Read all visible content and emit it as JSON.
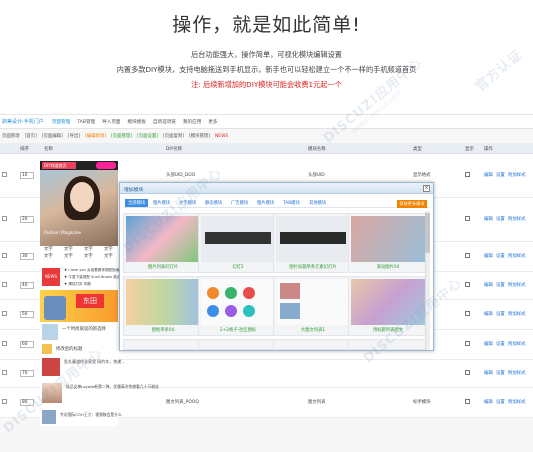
{
  "hero": {
    "title": "操作，就是如此简单!",
    "line1": "后台功能强大，操作简单，可视化模块编辑设置",
    "line2": "内置多款DIY模块，支持电脑拖送到手机显示，新手也可以轻松建立一个不一样的手机频道首页",
    "line3": "注: 后续新增加的DIY模块可能会收费1元起一个"
  },
  "topnav": {
    "brand": "启美设计-手机门户",
    "items": [
      "页面管理",
      "TAB管理",
      "导入页面",
      "模块模板",
      "自新选项链",
      "我的应用",
      "更多"
    ]
  },
  "subnav": {
    "items": [
      "页面管理",
      "[首页]",
      "[页面编辑]",
      "[导出]",
      "[编辑新增]",
      "[页面管理]",
      "[页面设置]",
      "[页面复制]",
      "[模块管理]",
      "NEWS"
    ]
  },
  "table": {
    "headers": [
      "排序",
      "名称",
      "DIY名称",
      "模块名称",
      "类型",
      "显示",
      "操作"
    ],
    "rows": [
      {
        "order": "10",
        "diy": "头部UID_DOO",
        "module": "头部UID",
        "module2": "头部UID",
        "type": "显示格式"
      },
      {
        "order": "20",
        "diy": "",
        "module": "",
        "module2": "",
        "type": ""
      },
      {
        "order": "30",
        "diy": "",
        "module": "",
        "module2": "",
        "type": ""
      },
      {
        "order": "40",
        "diy": "",
        "module": "",
        "module2": "",
        "type": ""
      },
      {
        "order": "50",
        "diy": "",
        "module": "",
        "module2": "",
        "type": ""
      },
      {
        "order": "60",
        "diy": "",
        "module": "",
        "module2": "",
        "type": ""
      },
      {
        "order": "70",
        "diy": "",
        "module": "",
        "module2": "",
        "type": ""
      },
      {
        "order": "80",
        "diy": "图文列表_POOQ",
        "module": "图文列表",
        "module2": "",
        "type": "标手模块"
      }
    ],
    "actions": [
      "编辑",
      "设置",
      "附加样式"
    ]
  },
  "left_preview": {
    "logo": "DIY频道首页",
    "caption": "Fashion Magazine",
    "bunk_texts": [
      "文字",
      "文字",
      "文字",
      "文字",
      "文字",
      "文字",
      "文字",
      "文字"
    ],
    "news": [
      "♦ I love you 女孩看服饰搭配指南",
      "♦ 牛童下装搭配 Snail Brown 新品",
      "♦ 情侣打折 同款"
    ],
    "items": [
      {
        "text": "一个时尚家居的新选择"
      },
      {
        "text": "修改后的标题"
      },
      {
        "text": "乱札童道作业家里 网约车，快递..."
      },
      {
        "text": "极品女神Loyalw新第二弹，优雅高冷性感看几十万粉丝"
      },
      {
        "text": "专访国际COO王力：视频移会是什么"
      }
    ]
  },
  "modal": {
    "title": "增加模块",
    "tabs": [
      "全部模块",
      "图片模块",
      "文字模块",
      "静态模块",
      "广告模块",
      "图片模块",
      "TAB模块",
      "其他模块"
    ],
    "button": "获取更多模块",
    "cards": [
      "图片列表幻灯片",
      "幻灯2",
      "图片标题单条元素幻灯片",
      "滚动图片04",
      "简短",
      "图框模块",
      "图框单条04",
      "2+2格子-社区图标",
      "大图文列表1",
      "帖子列表",
      "用标题列表图文",
      ""
    ]
  },
  "watermark": [
    "DISCUZ!应用中心",
    "addon.discuz.com",
    "官方认证"
  ]
}
